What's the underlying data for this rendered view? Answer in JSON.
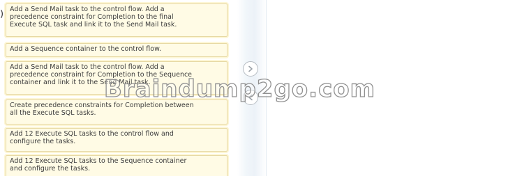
{
  "left_marker": ")",
  "actions": [
    {
      "text": "Add a Send Mail task to the control flow. Add a\nprecedence constraint for Completion to the final\nExecute SQL task and link it to the Send Mail task."
    },
    {
      "text": "Add a Sequence container to the control flow."
    },
    {
      "text": "Add a Send Mail task to the control flow. Add a\nprecedence constraint for Completion to the Sequence\ncontainer and link it to the Send Mail task."
    },
    {
      "text": "Create precedence constraints for Completion between\nall the Execute SQL tasks."
    },
    {
      "text": "Add 12 Execute SQL tasks to the control flow and\nconfigure the tasks."
    },
    {
      "text": "Add 12 Execute SQL tasks to the Sequence container\nand configure the tasks."
    }
  ],
  "buttons": {
    "move_right_icon": "chevron-right-icon",
    "move_left_icon": "chevron-left-icon"
  },
  "watermark": "Braindump2go.com",
  "colors": {
    "item_background": "#fffbe5",
    "item_border": "#e7d9a4",
    "button_border": "#b6bcc2",
    "watermark_outline": "#909090"
  }
}
